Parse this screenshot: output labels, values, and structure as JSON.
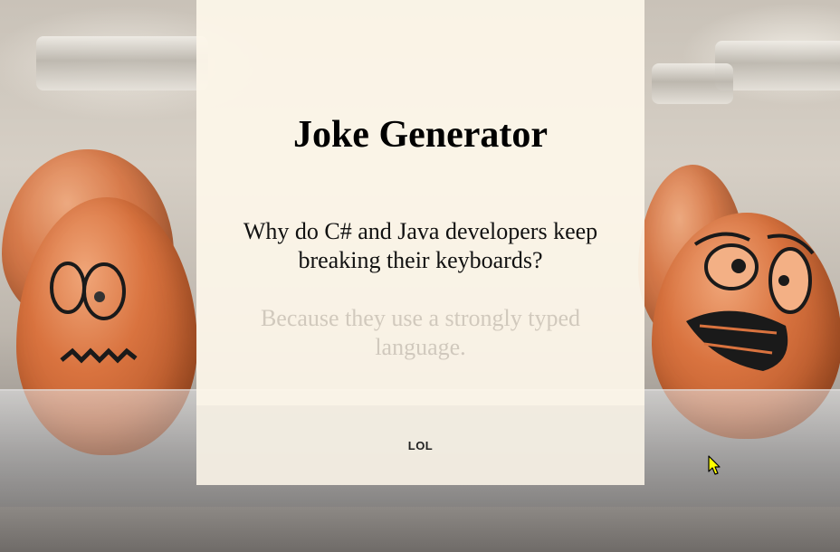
{
  "card": {
    "title": "Joke Generator",
    "question": "Why do C# and Java developers keep breaking their keyboards?",
    "answer": "Because they use a strongly typed language.",
    "button_label": "LOL"
  },
  "colors": {
    "card_background": "#fdf6ea",
    "title_text": "#000000",
    "answer_text_faded": "#a0968c",
    "cursor_fill": "#ffff00"
  },
  "icons": {
    "cursor": "mouse-pointer-icon"
  }
}
